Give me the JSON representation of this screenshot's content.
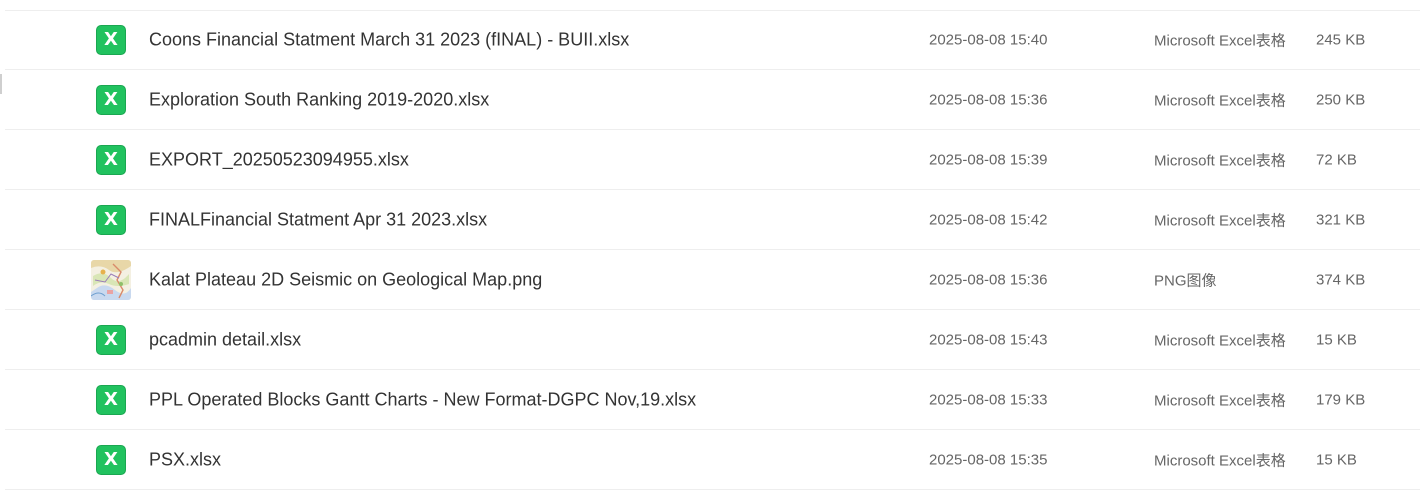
{
  "file_list": {
    "items": [
      {
        "name": "Coons Financial Statment March 31 2023 (fINAL) - BUII.xlsx",
        "modified": "2025-08-08 15:40",
        "type": "Microsoft Excel表格",
        "size": "245 KB",
        "icon": "excel-file-icon",
        "icon_letter": "X"
      },
      {
        "name": "Exploration South Ranking 2019-2020.xlsx",
        "modified": "2025-08-08 15:36",
        "type": "Microsoft Excel表格",
        "size": "250 KB",
        "icon": "excel-file-icon",
        "icon_letter": "X"
      },
      {
        "name": "EXPORT_20250523094955.xlsx",
        "modified": "2025-08-08 15:39",
        "type": "Microsoft Excel表格",
        "size": "72 KB",
        "icon": "excel-file-icon",
        "icon_letter": "X"
      },
      {
        "name": "FINALFinancial Statment Apr 31 2023.xlsx",
        "modified": "2025-08-08 15:42",
        "type": "Microsoft Excel表格",
        "size": "321 KB",
        "icon": "excel-file-icon",
        "icon_letter": "X"
      },
      {
        "name": "Kalat Plateau 2D Seismic on Geological Map.png",
        "modified": "2025-08-08 15:36",
        "type": "PNG图像",
        "size": "374 KB",
        "icon": "image-thumbnail"
      },
      {
        "name": "pcadmin detail.xlsx",
        "modified": "2025-08-08 15:43",
        "type": "Microsoft Excel表格",
        "size": "15 KB",
        "icon": "excel-file-icon",
        "icon_letter": "X"
      },
      {
        "name": "PPL Operated Blocks Gantt Charts - New Format-DGPC Nov,19.xlsx",
        "modified": "2025-08-08 15:33",
        "type": "Microsoft Excel表格",
        "size": "179 KB",
        "icon": "excel-file-icon",
        "icon_letter": "X"
      },
      {
        "name": "PSX.xlsx",
        "modified": "2025-08-08 15:35",
        "type": "Microsoft Excel表格",
        "size": "15 KB",
        "icon": "excel-file-icon",
        "icon_letter": "X"
      }
    ]
  },
  "colors": {
    "excel_green": "#21c25f",
    "text_primary": "#333333",
    "text_secondary": "#666666",
    "divider": "#eeeeee"
  }
}
